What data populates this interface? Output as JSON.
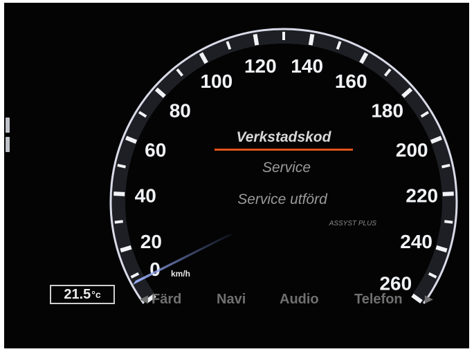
{
  "speedometer": {
    "scale_max": 260,
    "labels": [
      "20",
      "40",
      "60",
      "80",
      "100",
      "120",
      "140",
      "160",
      "180",
      "200",
      "220",
      "240",
      "260"
    ],
    "zero_label": "0",
    "unit": "km/h",
    "needle_value": 0
  },
  "message": {
    "title": "Verkstadskod",
    "line1": "Service",
    "line2": "Service utförd",
    "brand": "ASSYST PLUS"
  },
  "temperature": {
    "value": "21.5",
    "unit": "°c"
  },
  "menu": {
    "left_arrow": "◄",
    "items": [
      "Färd",
      "Navi",
      "Audio",
      "Telefon"
    ],
    "right_arrow": "►"
  },
  "colors": {
    "accent_line": "#e0541a",
    "ring": "#d9dbe8",
    "needle": "#7e93d6",
    "background": "#040404"
  }
}
